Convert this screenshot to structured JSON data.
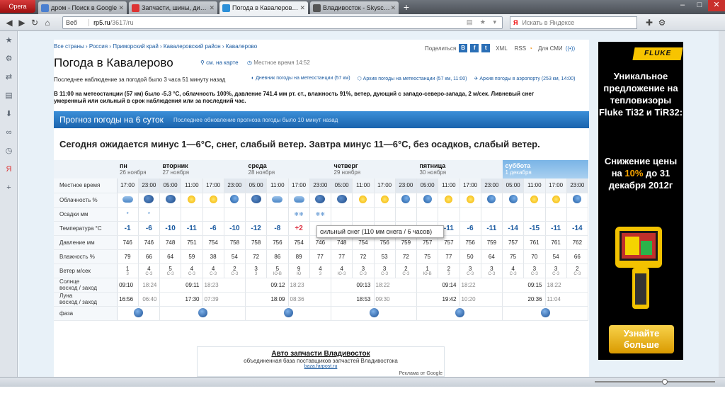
{
  "tabs": [
    {
      "label": "Opera"
    },
    {
      "label": "дром - Поиск в Google",
      "color": "#4a7fd0"
    },
    {
      "label": "Запчасти, шины, диск...",
      "color": "#d33"
    },
    {
      "label": "Погода в Кавалерово, ...",
      "color": "#2b8fd8",
      "active": true
    },
    {
      "label": "Владивосток - Skyscra...",
      "color": "#555"
    }
  ],
  "address": {
    "scheme": "Веб",
    "domain": "rp5.ru",
    "path": "/3617/ru",
    "search_placeholder": "Искать в Яндексе",
    "search_brand": "Я"
  },
  "breadcrumbs": "Все страны › Россия › Приморский край › Кавалеровский район › Кавалерово",
  "title": "Погода в Кавалерово",
  "on_map": "см. на карте",
  "local_time": "Местное время 14:52",
  "share": {
    "label": "Поделиться",
    "xml": "XML",
    "rss": "RSS",
    "sms": "Для СМИ"
  },
  "last_obs": "Последнее наблюдение за погодой было 3 часа 51 минуту назад",
  "links": [
    "Дневник погоды на метеостанции (57 км)",
    "Архив погоды на метеостанции (57 км, 11:00)",
    "Архив погоды в аэропорту (253 км, 14:00)"
  ],
  "obs_text_bold": "В 11:00 на метеостанции (57 км) было -5.3 °С, облачность 100%, давление 741.4 мм рт. ст., влажность 91%, ветер, дующий с западо-северо-запада, 2 м/сек. Ливневый снег",
  "obs_text_norm": "умеренный или сильный в срок наблюдения или за последний час.",
  "forecast_header": "Прогноз погоды на 6 суток",
  "forecast_update": "Последнее обновление прогноза погоды было 10 минут назад",
  "summary": "Сегодня ожидается минус 1—6°C, снег, слабый ветер. Завтра минус 11—6°C, без осадков, слабый ветер.",
  "row_labels": {
    "time": "Местное время",
    "cloud": "Облачность %",
    "precip": "Осадки мм",
    "temp": "Температура °С",
    "pressure": "Давление мм",
    "humidity": "Влажность %",
    "wind": "Ветер м/сек",
    "sun1": "Солнце",
    "sun2": "восход / заход",
    "moon1": "Луна",
    "moon2": "восход / заход",
    "phase": "фаза"
  },
  "days": [
    {
      "name": "пн",
      "date": "26 ноября",
      "span": 2
    },
    {
      "name": "вторник",
      "date": "27 ноября",
      "span": 4
    },
    {
      "name": "среда",
      "date": "28 ноября",
      "span": 4
    },
    {
      "name": "четверг",
      "date": "29 ноября",
      "span": 4
    },
    {
      "name": "пятница",
      "date": "30 ноября",
      "span": 4
    },
    {
      "name": "суббота",
      "date": "1 декабря",
      "span": 4
    }
  ],
  "cols": [
    {
      "time": "17:00",
      "icon": "cloud",
      "precip": "*",
      "temp": "-1",
      "p": "746",
      "h": "79",
      "w": "1",
      "wd": "3",
      "night": false
    },
    {
      "time": "23:00",
      "icon": "ncloud",
      "precip": "*",
      "temp": "-6",
      "p": "746",
      "h": "66",
      "w": "4",
      "wd": "С-З",
      "night": true
    },
    {
      "time": "05:00",
      "icon": "ncloud",
      "precip": "",
      "temp": "-10",
      "p": "748",
      "h": "64",
      "w": "5",
      "wd": "С-З",
      "night": true
    },
    {
      "time": "11:00",
      "icon": "sun",
      "precip": "",
      "temp": "-11",
      "p": "751",
      "h": "59",
      "w": "4",
      "wd": "С-З",
      "night": false
    },
    {
      "time": "17:00",
      "icon": "sun",
      "precip": "",
      "temp": "-6",
      "p": "754",
      "h": "38",
      "w": "4",
      "wd": "С-З",
      "night": false
    },
    {
      "time": "23:00",
      "icon": "moon",
      "precip": "",
      "temp": "-10",
      "p": "758",
      "h": "54",
      "w": "2",
      "wd": "С-З",
      "night": true
    },
    {
      "time": "05:00",
      "icon": "ncloud",
      "precip": "",
      "temp": "-12",
      "p": "758",
      "h": "72",
      "w": "3",
      "wd": "3",
      "night": true
    },
    {
      "time": "11:00",
      "icon": "cloud",
      "precip": "",
      "temp": "-8",
      "p": "756",
      "h": "86",
      "w": "5",
      "wd": "Ю-В",
      "night": false
    },
    {
      "time": "17:00",
      "icon": "cloud",
      "precip": "❄❄",
      "temp": "+2",
      "p": "754",
      "h": "89",
      "w": "9",
      "wd": "Ю",
      "night": false
    },
    {
      "time": "23:00",
      "icon": "ncloud",
      "precip": "❄❄",
      "temp": "",
      "p": "746",
      "h": "77",
      "w": "4",
      "wd": "3",
      "night": true
    },
    {
      "time": "05:00",
      "icon": "ncloud",
      "precip": "",
      "temp": "",
      "p": "748",
      "h": "77",
      "w": "4",
      "wd": "Ю-З",
      "night": true
    },
    {
      "time": "11:00",
      "icon": "sun",
      "precip": "",
      "temp": "",
      "p": "754",
      "h": "72",
      "w": "3",
      "wd": "С-З",
      "night": false
    },
    {
      "time": "17:00",
      "icon": "sun",
      "precip": "",
      "temp": "",
      "p": "756",
      "h": "53",
      "w": "3",
      "wd": "С-З",
      "night": false
    },
    {
      "time": "23:00",
      "icon": "moon",
      "precip": "",
      "temp": "",
      "p": "759",
      "h": "72",
      "w": "2",
      "wd": "С-З",
      "night": true
    },
    {
      "time": "05:00",
      "icon": "moon",
      "precip": "",
      "temp": "",
      "p": "757",
      "h": "75",
      "w": "1",
      "wd": "Ю-В",
      "night": true
    },
    {
      "time": "11:00",
      "icon": "sun",
      "precip": "",
      "temp": "-11",
      "p": "757",
      "h": "77",
      "w": "2",
      "wd": "3",
      "night": false
    },
    {
      "time": "17:00",
      "icon": "sun",
      "precip": "",
      "temp": "-6",
      "p": "756",
      "h": "50",
      "w": "3",
      "wd": "С-З",
      "night": false
    },
    {
      "time": "23:00",
      "icon": "moon",
      "precip": "",
      "temp": "-11",
      "p": "759",
      "h": "64",
      "w": "3",
      "wd": "С-З",
      "night": true
    },
    {
      "time": "05:00",
      "icon": "moon",
      "precip": "",
      "temp": "-14",
      "p": "757",
      "h": "75",
      "w": "4",
      "wd": "С-З",
      "night": true
    },
    {
      "time": "11:00",
      "icon": "sun",
      "precip": "",
      "temp": "-15",
      "p": "761",
      "h": "70",
      "w": "3",
      "wd": "С-З",
      "night": false
    },
    {
      "time": "17:00",
      "icon": "sun",
      "precip": "",
      "temp": "-11",
      "p": "761",
      "h": "54",
      "w": "3",
      "wd": "С-З",
      "night": false
    },
    {
      "time": "23:00",
      "icon": "moon",
      "precip": "",
      "temp": "-14",
      "p": "762",
      "h": "66",
      "w": "2",
      "wd": "С-З",
      "night": true
    }
  ],
  "sun": [
    {
      "rise": "09:10",
      "set": "18:24"
    },
    {
      "rise": "09:11",
      "set": "18:23"
    },
    {
      "rise": "09:12",
      "set": "18:23"
    },
    {
      "rise": "09:13",
      "set": "18:22"
    },
    {
      "rise": "09:14",
      "set": "18:22"
    },
    {
      "rise": "09:15",
      "set": "18:22"
    }
  ],
  "moon": [
    {
      "rise": "16:56",
      "set": "06:40"
    },
    {
      "rise": "17:30",
      "set": "07:39"
    },
    {
      "rise": "18:09",
      "set": "08:36"
    },
    {
      "rise": "18:53",
      "set": "09:30"
    },
    {
      "rise": "19:42",
      "set": "10:20"
    },
    {
      "rise": "20:36",
      "set": "11:04"
    }
  ],
  "tooltip": "сильный снег (110 мм снега / 6 часов)",
  "ad2": {
    "title": "Авто запчасти Владивосток",
    "desc": "объединенная база поставщиков запчастей Владивостока",
    "link": "baza.farpost.ru",
    "by": "Реклама от Google"
  },
  "fluke": {
    "logo": "FLUKE",
    "text": "Уникальное предложение на тепловизоры Fluke Ti32 и TiR32:",
    "sub_a": "Снижение цены на ",
    "sub_b": "10%",
    "sub_c": " до 31 декабря 2012г",
    "btn": "Узнайте больше"
  },
  "colors": {
    "accent": "#1a63ad",
    "warm": "#d33",
    "sat_header": "#7ab4e6",
    "ad_bg": "#000000",
    "ad_yellow": "#f7c400"
  }
}
